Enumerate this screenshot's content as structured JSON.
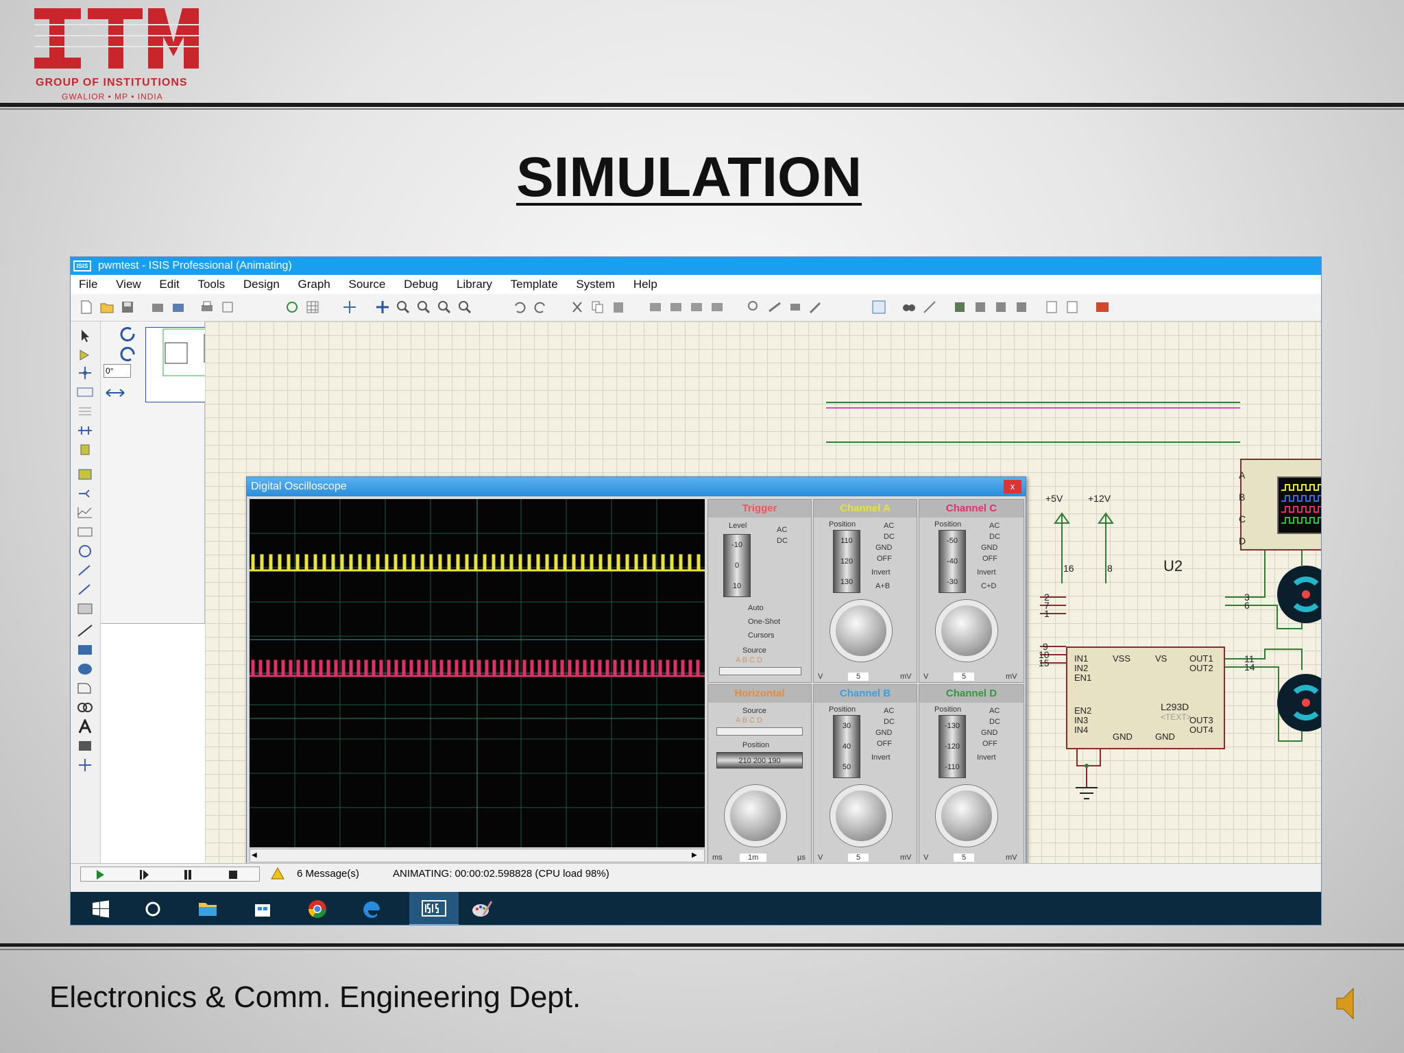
{
  "slide": {
    "logo_text": "ITM",
    "logo_line1": "GROUP OF INSTITUTIONS",
    "logo_line2": "GWALIOR • MP • INDIA",
    "title": "SIMULATION",
    "footer": "Electronics & Comm. Engineering Dept."
  },
  "window": {
    "title": "pwmtest - ISIS Professional (Animating)",
    "app_icon_text": "ISIS",
    "menu": [
      "File",
      "View",
      "Edit",
      "Tools",
      "Design",
      "Graph",
      "Source",
      "Debug",
      "Library",
      "Template",
      "System",
      "Help"
    ],
    "angle_field": "0°"
  },
  "oscilloscope": {
    "title": "Digital Oscilloscope",
    "close_label": "x",
    "trigger": {
      "label": "Trigger",
      "level_label": "Level",
      "level_values": [
        "-10",
        "0",
        "10"
      ],
      "ac": "AC",
      "dc": "DC",
      "auto": "Auto",
      "one_shot": "One-Shot",
      "cursors": "Cursors",
      "source_label": "Source",
      "sources": "A B C D"
    },
    "channel_a": {
      "label": "Channel A",
      "position_label": "Position",
      "values": [
        "110",
        "120",
        "130"
      ],
      "modes": [
        "AC",
        "DC",
        "GND",
        "OFF"
      ],
      "invert": "Invert",
      "extra": "A+B",
      "unit_left": "V",
      "unit_right": "mV",
      "setting": "5"
    },
    "channel_c": {
      "label": "Channel C",
      "position_label": "Position",
      "values": [
        "-50",
        "-40",
        "-30"
      ],
      "modes": [
        "AC",
        "DC",
        "GND",
        "OFF"
      ],
      "invert": "Invert",
      "extra": "C+D",
      "unit_left": "V",
      "unit_right": "mV",
      "setting": "5"
    },
    "horizontal": {
      "label": "Horizontal",
      "source_label": "Source",
      "sources": "A B C D",
      "position_label": "Position",
      "values": "210 200 190",
      "unit_left": "ms",
      "unit_right": "µs",
      "setting": "1m"
    },
    "channel_b": {
      "label": "Channel B",
      "position_label": "Position",
      "values": [
        "30",
        "40",
        "50"
      ],
      "modes": [
        "AC",
        "DC",
        "GND",
        "OFF"
      ],
      "invert": "Invert",
      "unit_left": "V",
      "unit_right": "mV",
      "setting": "5"
    },
    "channel_d": {
      "label": "Channel D",
      "position_label": "Position",
      "values": [
        "-130",
        "-120",
        "-110"
      ],
      "modes": [
        "AC",
        "DC",
        "GND",
        "OFF"
      ],
      "invert": "Invert",
      "unit_left": "V",
      "unit_right": "mV",
      "setting": "5"
    },
    "colors": {
      "a": "#e7e33a",
      "b": "#3aa0e0",
      "c": "#e0306a",
      "d": "#2e9a3a"
    }
  },
  "schematic": {
    "scope_pins": [
      "A",
      "B",
      "C",
      "D"
    ],
    "ic_ref": "U2",
    "ic_part": "L293D",
    "ic_text": "<TEXT>",
    "supply_5v": "+5V",
    "supply_12v": "+12V",
    "pin_16": "16",
    "pin_8": "8",
    "left_pins": [
      "IN1",
      "IN2",
      "EN1",
      "EN2",
      "IN3",
      "IN4"
    ],
    "left_pin_numbers": [
      "2",
      "7",
      "1",
      "9",
      "10",
      "15"
    ],
    "top_labels": [
      "VSS",
      "VS"
    ],
    "bottom_labels": [
      "GND",
      "GND"
    ],
    "right_pins": [
      "OUT1",
      "OUT2",
      "OUT3",
      "OUT4"
    ],
    "right_pin_numbers": [
      "3",
      "6",
      "11",
      "14"
    ]
  },
  "status": {
    "messages": "6 Message(s)",
    "animating": "ANIMATING: 00:00:02.598828 (CPU load 98%)"
  }
}
